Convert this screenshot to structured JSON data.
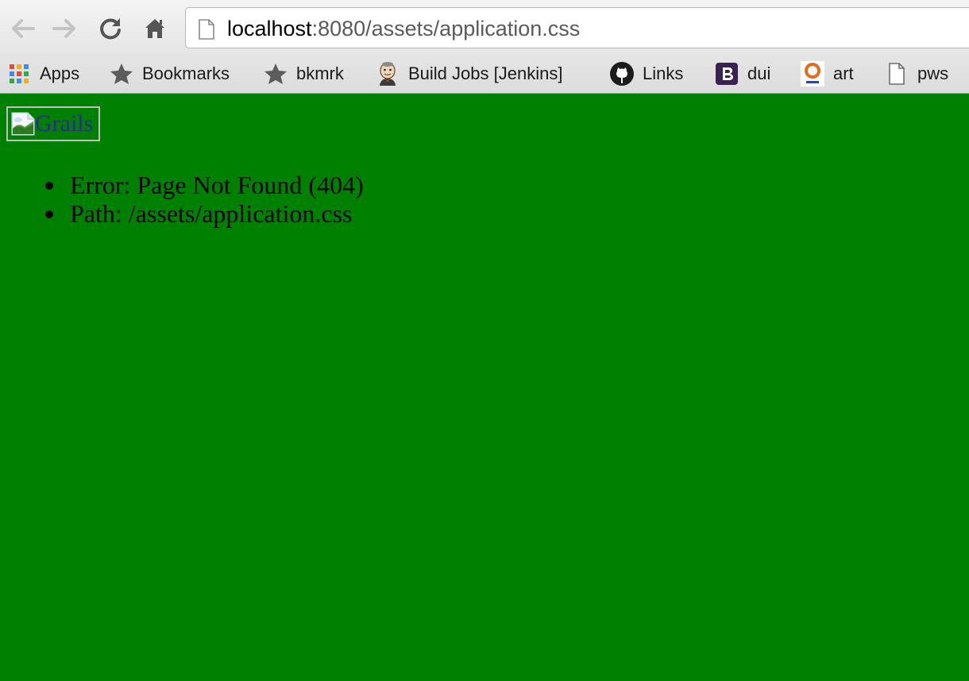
{
  "browser": {
    "url_host": "localhost",
    "url_rest": ":8080/assets/application.css",
    "icons": {
      "back": "back-arrow-icon",
      "forward": "forward-arrow-icon",
      "reload": "reload-icon",
      "home": "home-icon",
      "page": "page-icon"
    }
  },
  "bookmarks": [
    {
      "label": "Apps",
      "icon": "apps-grid-icon"
    },
    {
      "label": "Bookmarks",
      "icon": "star-icon"
    },
    {
      "label": "bkmrk",
      "icon": "star-icon"
    },
    {
      "label": "Build Jobs [Jenkins]",
      "icon": "jenkins-icon"
    },
    {
      "label": "Links",
      "icon": "github-icon"
    },
    {
      "label": "dui",
      "icon": "bootstrap-icon"
    },
    {
      "label": "art",
      "icon": "artifactory-icon"
    },
    {
      "label": "pws",
      "icon": "page-icon"
    }
  ],
  "page": {
    "logo_alt": "Grails",
    "errors": [
      "Error: Page Not Found (404)",
      "Path: /assets/application.css"
    ]
  },
  "colors": {
    "background": "#008000",
    "link": "#2c2c8c"
  }
}
